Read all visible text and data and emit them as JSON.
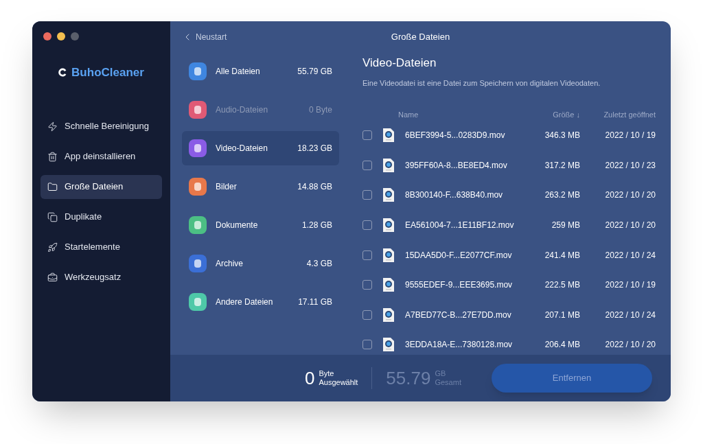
{
  "window": {
    "title": "Große Dateien"
  },
  "sidebar": {
    "logo": "BuhoCleaner",
    "items": [
      {
        "label": "Schnelle Bereinigung",
        "kind": "bolt",
        "selected": false
      },
      {
        "label": "App deinstallieren",
        "kind": "trash",
        "selected": false
      },
      {
        "label": "Große Dateien",
        "kind": "folder",
        "selected": true
      },
      {
        "label": "Duplikate",
        "kind": "duplicate",
        "selected": false
      },
      {
        "label": "Startelemente",
        "kind": "rocket",
        "selected": false
      },
      {
        "label": "Werkzeugsatz",
        "kind": "toolbox",
        "selected": false
      }
    ]
  },
  "back": "Neustart",
  "categories": [
    {
      "label": "Alle Dateien",
      "size": "55.79 GB",
      "color": "#3f86e0",
      "selected": false,
      "disabled": false
    },
    {
      "label": "Audio-Dateien",
      "size": "0 Byte",
      "color": "#e05a75",
      "selected": false,
      "disabled": true
    },
    {
      "label": "Video-Dateien",
      "size": "18.23 GB",
      "color": "#8a5ce6",
      "selected": true,
      "disabled": false
    },
    {
      "label": "Bilder",
      "size": "14.88 GB",
      "color": "#e8784a",
      "selected": false,
      "disabled": false
    },
    {
      "label": "Dokumente",
      "size": "1.28 GB",
      "color": "#4cbf84",
      "selected": false,
      "disabled": false
    },
    {
      "label": "Archive",
      "size": "4.3 GB",
      "color": "#3b6fd6",
      "selected": false,
      "disabled": false
    },
    {
      "label": "Andere Dateien",
      "size": "17.11 GB",
      "color": "#4ec9a8",
      "selected": false,
      "disabled": false
    }
  ],
  "detail": {
    "title": "Video-Dateien",
    "description": "Eine Videodatei ist eine Datei zum Speichern von digitalen Videodaten."
  },
  "table": {
    "columns": [
      "Name",
      "Größe ↓",
      "Zuletzt geöffnet"
    ],
    "rows": [
      {
        "name": "6BEF3994-5...0283D9.mov",
        "size": "346.3 MB",
        "date": "2022 / 10 / 19",
        "checked": false
      },
      {
        "name": "395FF60A-8...BE8ED4.mov",
        "size": "317.2 MB",
        "date": "2022 / 10 / 23",
        "checked": false
      },
      {
        "name": "8B300140-F...638B40.mov",
        "size": "263.2 MB",
        "date": "2022 / 10 / 20",
        "checked": false
      },
      {
        "name": "EA561004-7...1E11BF12.mov",
        "size": "259 MB",
        "date": "2022 / 10 / 20",
        "checked": false
      },
      {
        "name": "15DAA5D0-F...E2077CF.mov",
        "size": "241.4 MB",
        "date": "2022 / 10 / 24",
        "checked": false
      },
      {
        "name": "9555EDEF-9...EEE3695.mov",
        "size": "222.5 MB",
        "date": "2022 / 10 / 19",
        "checked": false
      },
      {
        "name": "A7BED77C-B...27E7DD.mov",
        "size": "207.1 MB",
        "date": "2022 / 10 / 24",
        "checked": false
      },
      {
        "name": "3EDDA18A-E...7380128.mov",
        "size": "206.4 MB",
        "date": "2022 / 10 / 20",
        "checked": false
      }
    ]
  },
  "footer": {
    "selected_value": "0",
    "selected_unit": "Byte",
    "selected_label": "Ausgewählt",
    "total_value": "55.79",
    "total_unit": "GB",
    "total_label": "Gesamt",
    "button": "Entfernen",
    "button_disabled": true
  }
}
